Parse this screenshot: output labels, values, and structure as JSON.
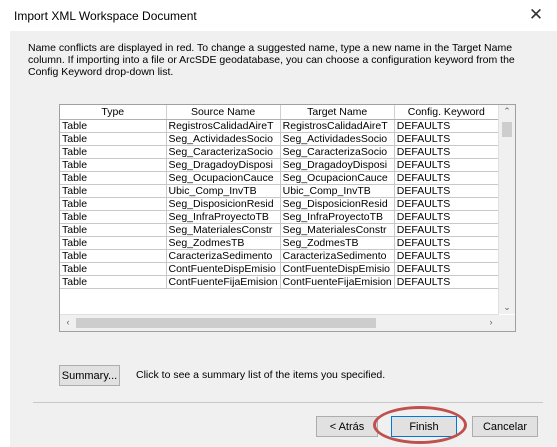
{
  "window": {
    "title": "Import XML Workspace Document"
  },
  "description": "Name conflicts are displayed in red. To change a suggested name, type a new name in the Target Name column. If importing into a file or ArcSDE geodatabase, you can choose a configuration keyword from the Config Keyword drop-down list.",
  "table": {
    "columns": [
      "Type",
      "Source Name",
      "Target Name",
      "Config. Keyword"
    ],
    "rows": [
      [
        "Table",
        "RegistrosCalidadAireT",
        "RegistrosCalidadAireT",
        "DEFAULTS"
      ],
      [
        "Table",
        "Seg_ActividadesSocio",
        "Seg_ActividadesSocio",
        "DEFAULTS"
      ],
      [
        "Table",
        "Seg_CaracterizaSocio",
        "Seg_CaracterizaSocio",
        "DEFAULTS"
      ],
      [
        "Table",
        "Seg_DragadoyDisposi",
        "Seg_DragadoyDisposi",
        "DEFAULTS"
      ],
      [
        "Table",
        "Seg_OcupacionCauce",
        "Seg_OcupacionCauce",
        "DEFAULTS"
      ],
      [
        "Table",
        "Ubic_Comp_InvTB",
        "Ubic_Comp_InvTB",
        "DEFAULTS"
      ],
      [
        "Table",
        "Seg_DisposicionResid",
        "Seg_DisposicionResid",
        "DEFAULTS"
      ],
      [
        "Table",
        "Seg_InfraProyectoTB",
        "Seg_InfraProyectoTB",
        "DEFAULTS"
      ],
      [
        "Table",
        "Seg_MaterialesConstr",
        "Seg_MaterialesConstr",
        "DEFAULTS"
      ],
      [
        "Table",
        "Seg_ZodmesTB",
        "Seg_ZodmesTB",
        "DEFAULTS"
      ],
      [
        "Table",
        "CaracterizaSedimento",
        "CaracterizaSedimento",
        "DEFAULTS"
      ],
      [
        "Table",
        "ContFuenteDispEmisio",
        "ContFuenteDispEmisio",
        "DEFAULTS"
      ],
      [
        "Table",
        "ContFuenteFijaEmision",
        "ContFuenteFijaEmision",
        "DEFAULTS"
      ]
    ]
  },
  "summary": {
    "button_label": "Summary...",
    "text": "Click to see a summary list of the items you specified."
  },
  "buttons": {
    "back": "< Atrás",
    "finish": "Finish",
    "cancel": "Cancelar"
  },
  "icons": {
    "close": "close-icon",
    "scroll_up": "chevron-up-icon",
    "scroll_down": "chevron-down-icon",
    "scroll_left": "chevron-left-icon",
    "scroll_right": "chevron-right-icon"
  },
  "colors": {
    "highlight": "#c0504d",
    "focus": "#0078d7"
  }
}
